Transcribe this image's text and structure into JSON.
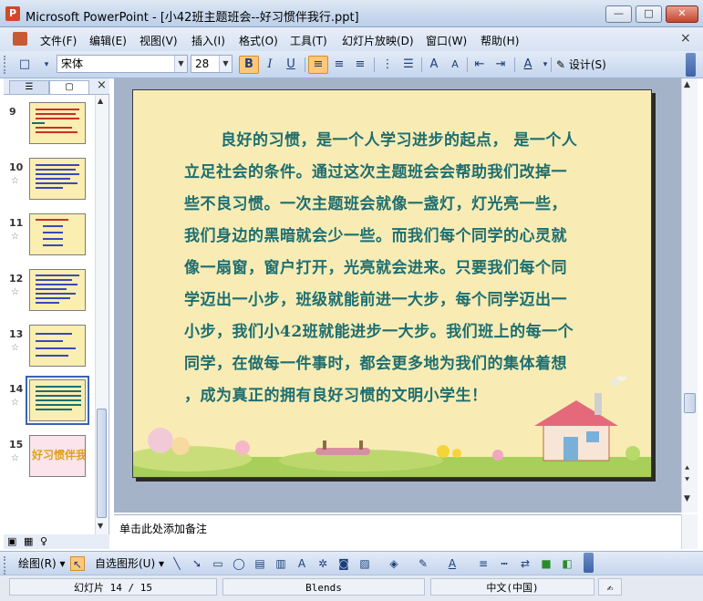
{
  "window": {
    "title": "Microsoft PowerPoint - [小42班主题班会--好习惯伴我行.ppt]",
    "app_icon": "P",
    "min_glyph": "—",
    "max_glyph": "□",
    "close_glyph": "✕"
  },
  "menu": {
    "items": [
      "文件(F)",
      "编辑(E)",
      "视图(V)",
      "插入(I)",
      "格式(O)",
      "工具(T)",
      "幻灯片放映(D)",
      "窗口(W)",
      "帮助(H)"
    ],
    "doc_close": "×"
  },
  "toolbar": {
    "font_name": "宋体",
    "font_size": "28",
    "bold": "B",
    "italic": "I",
    "underline": "U",
    "design_label": "设计(S)"
  },
  "slides_pane": {
    "close": "×",
    "thumbnails": [
      {
        "number": "9",
        "star": ""
      },
      {
        "number": "10",
        "star": "☆"
      },
      {
        "number": "11",
        "star": "☆"
      },
      {
        "number": "12",
        "star": "☆"
      },
      {
        "number": "13",
        "star": "☆"
      },
      {
        "number": "14",
        "star": "☆",
        "selected": true
      },
      {
        "number": "15",
        "star": "☆",
        "label": "好习惯伴我行"
      }
    ]
  },
  "slide": {
    "paragraph": "良好的习惯，是一个人学习进步的起点， 是一个人立足社会的条件。通过这次主题班会会帮助我们改掉一些不良习惯。一次主题班会就像一盏灯，灯光亮一些，我们身边的黑暗就会少一些。而我们每个同学的心灵就像一扇窗，窗户打开，光亮就会进来。只要我们每个同学迈出一小步，班级就能前进一大步，每个同学迈出一小步，我们小42班就能进步一大步。我们班上的每一个同学，在做每一件事时，都会更多地为我们的集体着想，成为真正的拥有良好习惯的文明小学生！",
    "lines": [
      "良好的习惯，是一个人学习进步的起点， 是一个人",
      "立足社会的条件。通过这次主题班会会帮助我们改掉一",
      "些不良习惯。一次主题班会就像一盏灯，灯光亮一些，",
      "我们身边的黑暗就会少一些。而我们每个同学的心灵就",
      "像一扇窗，窗户打开，光亮就会进来。只要我们每个同",
      "学迈出一小步，班级就能前进一大步，每个同学迈出一",
      "小步，我们小42班就能进步一大步。我们班上的每一个",
      "同学，在做每一件事时，都会更多地为我们的集体着想",
      "，成为真正的拥有良好习惯的文明小学生！"
    ],
    "text_color": "#1e6e70",
    "background_color": "#f8ecb4"
  },
  "notes": {
    "placeholder": "单击此处添加备注"
  },
  "drawing_toolbar": {
    "draw_label": "绘图(R)",
    "autoshapes_label": "自选图形(U)"
  },
  "status": {
    "slide_info": "幻灯片 14 / 15",
    "design": "Blends",
    "language": "中文(中国)"
  }
}
